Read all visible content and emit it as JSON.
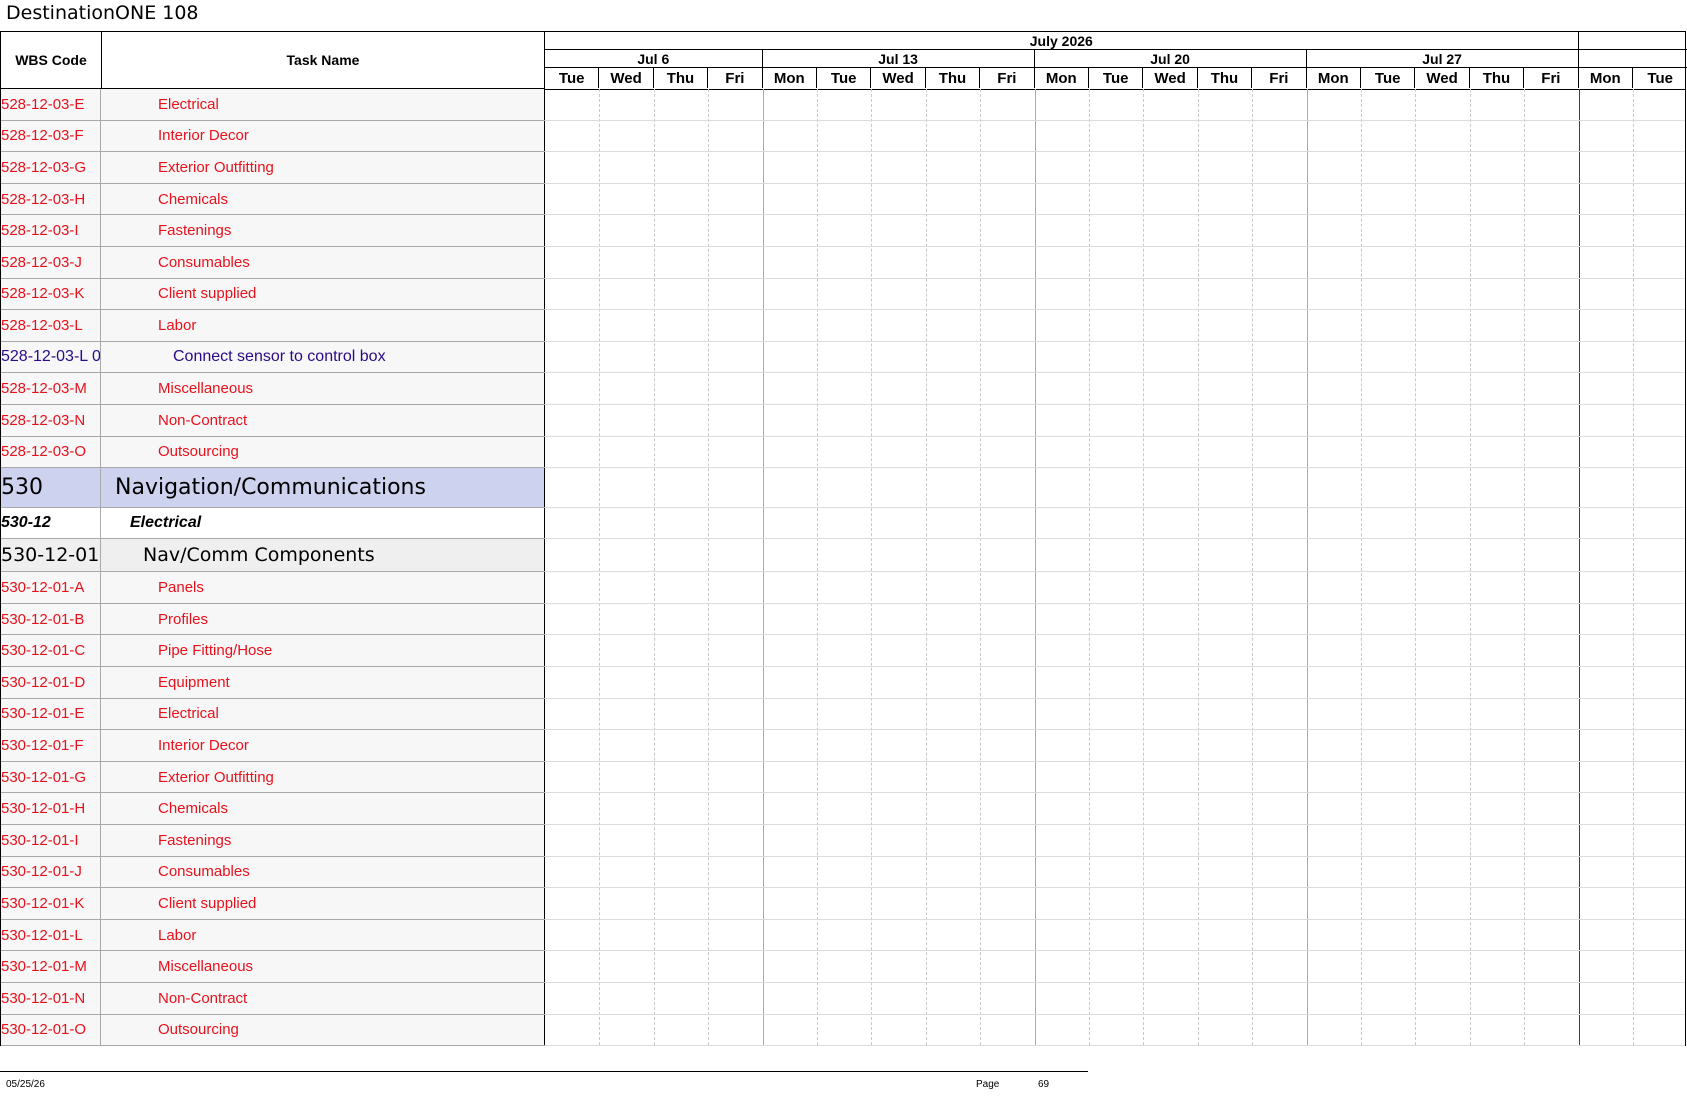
{
  "document": {
    "title": "DestinationONE 108"
  },
  "header": {
    "wbs_code": "WBS Code",
    "task_name": "Task Name"
  },
  "timescale": {
    "month": "July 2026",
    "weeks": [
      {
        "label": "Jul 6",
        "days": [
          "Tue",
          "Wed",
          "Thu",
          "Fri"
        ]
      },
      {
        "label": "Jul 13",
        "days": [
          "Mon",
          "Tue",
          "Wed",
          "Thu",
          "Fri"
        ]
      },
      {
        "label": "Jul 20",
        "days": [
          "Mon",
          "Tue",
          "Wed",
          "Thu",
          "Fri"
        ]
      },
      {
        "label": "Jul 27",
        "days": [
          "Mon",
          "Tue",
          "Wed",
          "Thu",
          "Fri"
        ]
      },
      {
        "label": "",
        "days": [
          "Mon",
          "Tue"
        ]
      }
    ]
  },
  "rows": [
    {
      "code": "528-12-03-E",
      "name": "Electrical",
      "level": "task"
    },
    {
      "code": "528-12-03-F",
      "name": "Interior Decor",
      "level": "task"
    },
    {
      "code": "528-12-03-G",
      "name": "Exterior Outfitting",
      "level": "task"
    },
    {
      "code": "528-12-03-H",
      "name": "Chemicals",
      "level": "task"
    },
    {
      "code": "528-12-03-I",
      "name": "Fastenings",
      "level": "task"
    },
    {
      "code": "528-12-03-J",
      "name": "Consumables",
      "level": "task"
    },
    {
      "code": "528-12-03-K",
      "name": "Client supplied",
      "level": "task"
    },
    {
      "code": "528-12-03-L",
      "name": "Labor",
      "level": "task"
    },
    {
      "code": "528-12-03-L 0",
      "name": "Connect sensor to control box",
      "level": "sub"
    },
    {
      "code": "528-12-03-M",
      "name": "Miscellaneous",
      "level": "task"
    },
    {
      "code": "528-12-03-N",
      "name": "Non-Contract",
      "level": "task"
    },
    {
      "code": "528-12-03-O",
      "name": "Outsourcing",
      "level": "task"
    },
    {
      "code": "530",
      "name": "Navigation/Communications",
      "level": "top"
    },
    {
      "code": "530-12",
      "name": "Electrical",
      "level": "mid"
    },
    {
      "code": "530-12-01",
      "name": "Nav/Comm Components",
      "level": "grp"
    },
    {
      "code": "530-12-01-A",
      "name": "Panels",
      "level": "task"
    },
    {
      "code": "530-12-01-B",
      "name": "Profiles",
      "level": "task"
    },
    {
      "code": "530-12-01-C",
      "name": "Pipe Fitting/Hose",
      "level": "task"
    },
    {
      "code": "530-12-01-D",
      "name": "Equipment",
      "level": "task"
    },
    {
      "code": "530-12-01-E",
      "name": "Electrical",
      "level": "task"
    },
    {
      "code": "530-12-01-F",
      "name": "Interior Decor",
      "level": "task"
    },
    {
      "code": "530-12-01-G",
      "name": "Exterior Outfitting",
      "level": "task"
    },
    {
      "code": "530-12-01-H",
      "name": "Chemicals",
      "level": "task"
    },
    {
      "code": "530-12-01-I",
      "name": "Fastenings",
      "level": "task"
    },
    {
      "code": "530-12-01-J",
      "name": "Consumables",
      "level": "task"
    },
    {
      "code": "530-12-01-K",
      "name": "Client supplied",
      "level": "task"
    },
    {
      "code": "530-12-01-L",
      "name": "Labor",
      "level": "task"
    },
    {
      "code": "530-12-01-M",
      "name": "Miscellaneous",
      "level": "task"
    },
    {
      "code": "530-12-01-N",
      "name": "Non-Contract",
      "level": "task"
    },
    {
      "code": "530-12-01-O",
      "name": "Outsourcing",
      "level": "task"
    }
  ],
  "footer": {
    "date": "05/25/26",
    "page_label": "Page",
    "page_number": "69"
  }
}
